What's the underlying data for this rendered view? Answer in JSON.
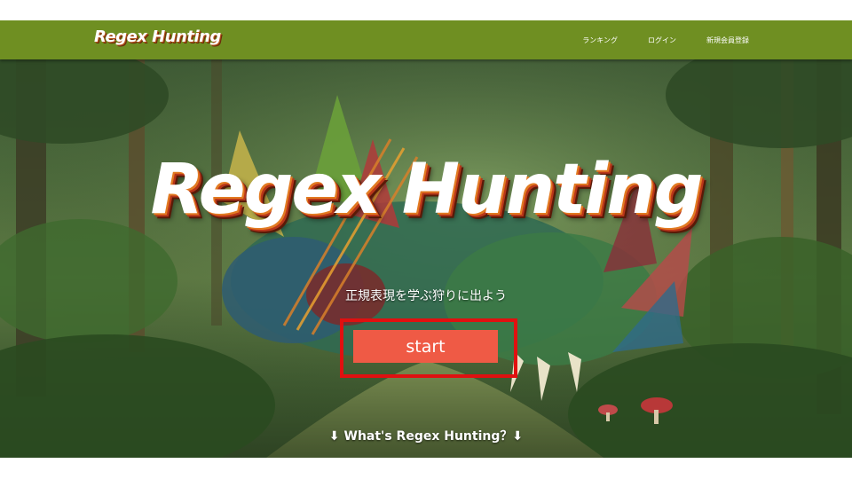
{
  "app": {
    "logo_text": "Regex Hunting"
  },
  "nav": {
    "links": [
      "ランキング",
      "ログイン",
      "新規会員登録"
    ]
  },
  "hero": {
    "title": "Regex Hunting",
    "subtitle": "正規表現を学ぶ狩りに出よう",
    "start_label": "start",
    "what_label": "⬇ What's Regex Hunting？⬇"
  },
  "colors": {
    "nav_bg": "#6f8f22",
    "start_button": "#ef5a45",
    "highlight_border": "#e01010"
  }
}
